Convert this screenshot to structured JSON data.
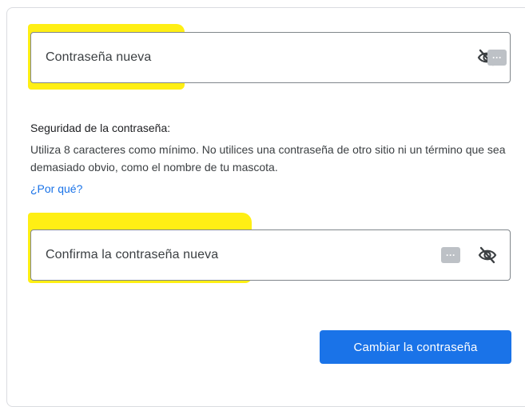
{
  "form": {
    "new_password": {
      "label": "Contraseña nueva",
      "value": "",
      "icons": [
        "password-manager-icon",
        "eye-slash-icon"
      ]
    },
    "strength": {
      "title": "Seguridad de la contraseña:",
      "text": "Utiliza 8 caracteres como mínimo. No utilices una contraseña de otro sitio ni un término que sea demasiado obvio, como el nombre de tu mascota.",
      "link": "¿Por qué?"
    },
    "confirm_password": {
      "label": "Confirma la contraseña nueva",
      "value": "",
      "icons": [
        "password-manager-icon",
        "eye-slash-icon"
      ]
    },
    "submit_label": "Cambiar la contraseña"
  },
  "pw_manager_glyph": "···",
  "colors": {
    "highlight": "#ffee00",
    "primary": "#1a73e8",
    "field_border": "#80868b",
    "card_border": "#dadce0"
  }
}
